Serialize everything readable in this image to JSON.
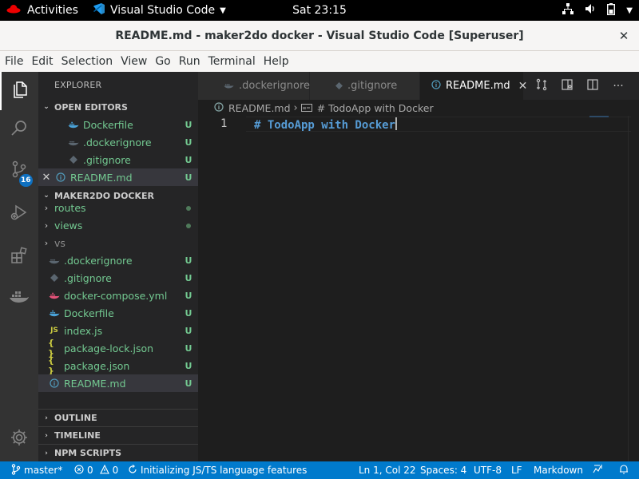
{
  "topbar": {
    "activities": "Activities",
    "app_name": "Visual Studio Code",
    "clock": "Sat 23:15"
  },
  "window": {
    "title": "README.md - maker2do docker - Visual Studio Code [Superuser]"
  },
  "menu": [
    "File",
    "Edit",
    "Selection",
    "View",
    "Go",
    "Run",
    "Terminal",
    "Help"
  ],
  "activity_bar": {
    "scm_badge": "16"
  },
  "explorer": {
    "title": "EXPLORER",
    "open_editors_header": "OPEN EDITORS",
    "open_editors": [
      {
        "name": "Dockerfile",
        "status": "U"
      },
      {
        "name": ".dockerignore",
        "status": "U"
      },
      {
        "name": ".gitignore",
        "status": "U"
      },
      {
        "name": "README.md",
        "status": "U"
      }
    ],
    "workspace_header": "MAKER2DO DOCKER",
    "tree": [
      {
        "name": "routes",
        "status": ""
      },
      {
        "name": "views",
        "status": ""
      },
      {
        "name": "vs",
        "status": ""
      },
      {
        "name": ".dockerignore",
        "status": "U"
      },
      {
        "name": ".gitignore",
        "status": "U"
      },
      {
        "name": "docker-compose.yml",
        "status": "U"
      },
      {
        "name": "Dockerfile",
        "status": "U"
      },
      {
        "name": "index.js",
        "status": "U"
      },
      {
        "name": "package-lock.json",
        "status": "U"
      },
      {
        "name": "package.json",
        "status": "U"
      },
      {
        "name": "README.md",
        "status": "U"
      }
    ],
    "outline": "OUTLINE",
    "timeline": "TIMELINE",
    "npm_scripts": "NPM SCRIPTS",
    "icon_labels": {
      "js": "JS",
      "json": "{ }"
    }
  },
  "tabs": [
    {
      "label": ".dockerignore"
    },
    {
      "label": ".gitignore"
    },
    {
      "label": "README.md"
    }
  ],
  "breadcrumb": {
    "file": "README.md",
    "symbol": "# TodoApp with Docker"
  },
  "editor": {
    "line_number": "1",
    "line_text": "# TodoApp with Docker",
    "text_color": "#569cd6"
  },
  "statusbar": {
    "branch": "master*",
    "errors": "0",
    "warnings": "0",
    "task": "Initializing JS/TS language features",
    "position": "Ln 1, Col 22",
    "spaces": "Spaces: 4",
    "encoding": "UTF-8",
    "eol": "LF",
    "language": "Markdown",
    "color": "#007acc"
  }
}
